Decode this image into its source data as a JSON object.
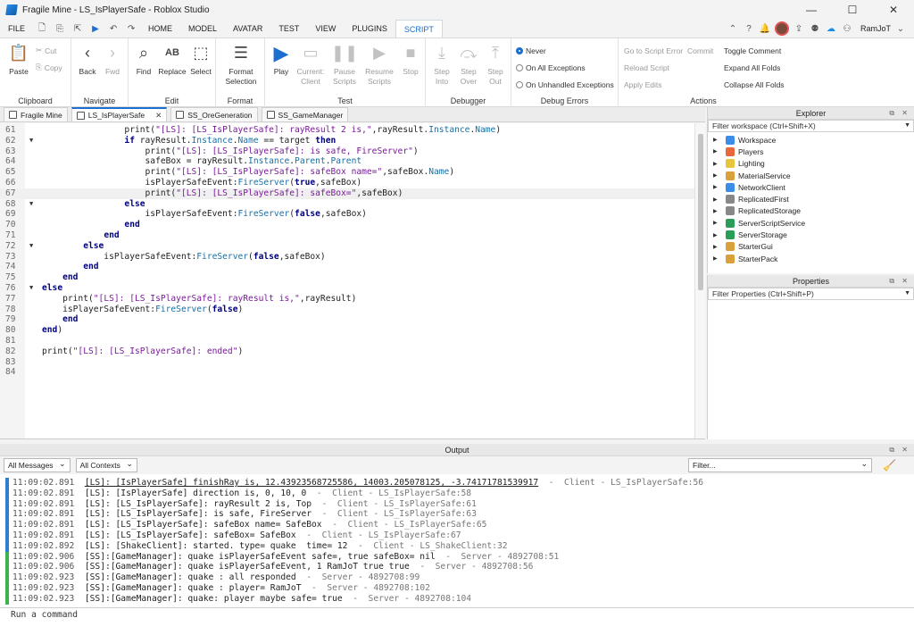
{
  "window": {
    "title": "Fragile Mine - LS_IsPlayerSafe - Roblox Studio",
    "min": "—",
    "max": "☐",
    "close": "✕"
  },
  "menu": {
    "items": [
      "FILE",
      "HOME",
      "MODEL",
      "AVATAR",
      "TEST",
      "VIEW",
      "PLUGINS",
      "SCRIPT"
    ],
    "active": "SCRIPT",
    "user": "RamJoT"
  },
  "ribbon": {
    "clipboard": {
      "label": "Clipboard",
      "paste": "Paste",
      "cut": "Cut",
      "copy": "Copy"
    },
    "navigate": {
      "label": "Navigate",
      "back": "Back",
      "fwd": "Fwd"
    },
    "edit": {
      "label": "Edit",
      "find": "Find",
      "replace": "Replace",
      "select": "Select"
    },
    "format": {
      "label": "Format",
      "format_selection": "Format Selection"
    },
    "test": {
      "label": "Test",
      "play": "Play",
      "current": "Current: Client",
      "pause": "Pause Scripts",
      "resume": "Resume Scripts",
      "stop": "Stop"
    },
    "debugger": {
      "label": "Debugger",
      "step_into": "Step Into",
      "step_over": "Step Over",
      "step_out": "Step Out"
    },
    "debug_errors": {
      "label": "Debug Errors",
      "never": "Never",
      "all": "On All Exceptions",
      "unhandled": "On Unhandled Exceptions"
    },
    "actions": {
      "label": "Actions",
      "goto": "Go to Script Error",
      "commit": "Commit",
      "reload": "Reload Script",
      "apply": "Apply Edits",
      "toggle_comment": "Toggle Comment",
      "expand": "Expand All Folds",
      "collapse": "Collapse All Folds"
    }
  },
  "tabs": [
    {
      "label": "Fragile Mine",
      "active": false
    },
    {
      "label": "LS_IsPlayerSafe",
      "active": true
    },
    {
      "label": "SS_OreGeneration",
      "active": false
    },
    {
      "label": "SS_GameManager",
      "active": false
    }
  ],
  "explorer": {
    "title": "Explorer",
    "filter": "Filter workspace (Ctrl+Shift+X)",
    "items": [
      "Workspace",
      "Players",
      "Lighting",
      "MaterialService",
      "NetworkClient",
      "ReplicatedFirst",
      "ReplicatedStorage",
      "ServerScriptService",
      "ServerStorage",
      "StarterGui",
      "StarterPack"
    ]
  },
  "properties": {
    "title": "Properties",
    "filter": "Filter Properties (Ctrl+Shift+P)"
  },
  "output": {
    "title": "Output",
    "messages_filter": "All Messages",
    "contexts_filter": "All Contexts",
    "filter_placeholder": "Filter...",
    "command_placeholder": "Run a command"
  },
  "code_lines": [
    {
      "n": "61",
      "text": "                print(\"[LS]: [LS_IsPlayerSafe]: rayResult 2 is,\",rayResult.Instance.Name)"
    },
    {
      "n": "62",
      "text": "                if rayResult.Instance.Name == target then",
      "fold": true
    },
    {
      "n": "63",
      "text": "                    print(\"[LS]: [LS_IsPlayerSafe]: is safe, FireServer\")"
    },
    {
      "n": "64",
      "text": "                    safeBox = rayResult.Instance.Parent.Parent"
    },
    {
      "n": "65",
      "text": "                    print(\"[LS]: [LS_IsPlayerSafe]: safeBox name=\",safeBox.Name)"
    },
    {
      "n": "66",
      "text": "                    isPlayerSafeEvent:FireServer(true,safeBox)"
    },
    {
      "n": "67",
      "text": "                    print(\"[LS]: [LS_IsPlayerSafe]: safeBox=\",safeBox)",
      "hl": true
    },
    {
      "n": "68",
      "text": "                else",
      "fold": true
    },
    {
      "n": "69",
      "text": "                    isPlayerSafeEvent:FireServer(false,safeBox)"
    },
    {
      "n": "70",
      "text": "                end"
    },
    {
      "n": "71",
      "text": "            end"
    },
    {
      "n": "72",
      "text": "        else",
      "fold": true
    },
    {
      "n": "73",
      "text": "            isPlayerSafeEvent:FireServer(false,safeBox)"
    },
    {
      "n": "74",
      "text": "        end"
    },
    {
      "n": "75",
      "text": "    end"
    },
    {
      "n": "76",
      "text": "else",
      "fold": true
    },
    {
      "n": "77",
      "text": "    print(\"[LS]: [LS_IsPlayerSafe]: rayResult is,\",rayResult)"
    },
    {
      "n": "78",
      "text": "    isPlayerSafeEvent:FireServer(false)"
    },
    {
      "n": "79",
      "text": "    end"
    },
    {
      "n": "80",
      "text": "end)"
    },
    {
      "n": "81",
      "text": ""
    },
    {
      "n": "82",
      "text": "print(\"[LS]: [LS_IsPlayerSafe]: ended\")"
    },
    {
      "n": "83",
      "text": ""
    },
    {
      "n": "84",
      "text": ""
    }
  ],
  "log_lines": [
    {
      "ts": "11:09:02.891",
      "msg": "[LS]: [IsPlayerSafe] finishRay is, 12.43923568725586, 14003.205078125, -3.74171781539917",
      "src": "  -  Client - LS_IsPlayerSafe:56",
      "kind": "client"
    },
    {
      "ts": "11:09:02.891",
      "msg": "[LS]: [IsPlayerSafe] direction is, 0, 10, 0",
      "src": "  -  Client - LS_IsPlayerSafe:58",
      "kind": "client"
    },
    {
      "ts": "11:09:02.891",
      "msg": "[LS]: [LS_IsPlayerSafe]: rayResult 2 is, Top",
      "src": "  -  Client - LS_IsPlayerSafe:61",
      "kind": "client"
    },
    {
      "ts": "11:09:02.891",
      "msg": "[LS]: [LS_IsPlayerSafe]: is safe, FireServer",
      "src": "  -  Client - LS_IsPlayerSafe:63",
      "kind": "client"
    },
    {
      "ts": "11:09:02.891",
      "msg": "[LS]: [LS_IsPlayerSafe]: safeBox name= SafeBox",
      "src": "  -  Client - LS_IsPlayerSafe:65",
      "kind": "client"
    },
    {
      "ts": "11:09:02.891",
      "msg": "[LS]: [LS_IsPlayerSafe]: safeBox= SafeBox",
      "src": "  -  Client - LS_IsPlayerSafe:67",
      "kind": "client"
    },
    {
      "ts": "11:09:02.892",
      "msg": "[LS]: [ShakeClient]: started. type= quake  time= 12",
      "src": "  -  Client - LS_ShakeClient:32",
      "kind": "client"
    },
    {
      "ts": "11:09:02.906",
      "msg": "[SS]:[GameManager]: quake isPlayerSafeEvent safe=, true safeBox= nil",
      "src": "  -  Server - 4892708:51",
      "kind": "server"
    },
    {
      "ts": "11:09:02.906",
      "msg": "[SS]:[GameManager]: quake isPlayerSafeEvent, 1 RamJoT true true",
      "src": "  -  Server - 4892708:56",
      "kind": "server"
    },
    {
      "ts": "11:09:02.923",
      "msg": "[SS]:[GameManager]: quake : all responded",
      "src": "  -  Server - 4892708:99",
      "kind": "server"
    },
    {
      "ts": "11:09:02.923",
      "msg": "[SS]:[GameManager]: quake : player= RamJoT",
      "src": "  -  Server - 4892708:102",
      "kind": "server"
    },
    {
      "ts": "11:09:02.923",
      "msg": "[SS]:[GameManager]: quake: player maybe safe= true",
      "src": "  -  Server - 4892708:104",
      "kind": "server"
    }
  ],
  "colors": {
    "accent": "#1a6fd1",
    "client_bar": "#2f7fd1",
    "server_bar": "#3cb44b"
  }
}
